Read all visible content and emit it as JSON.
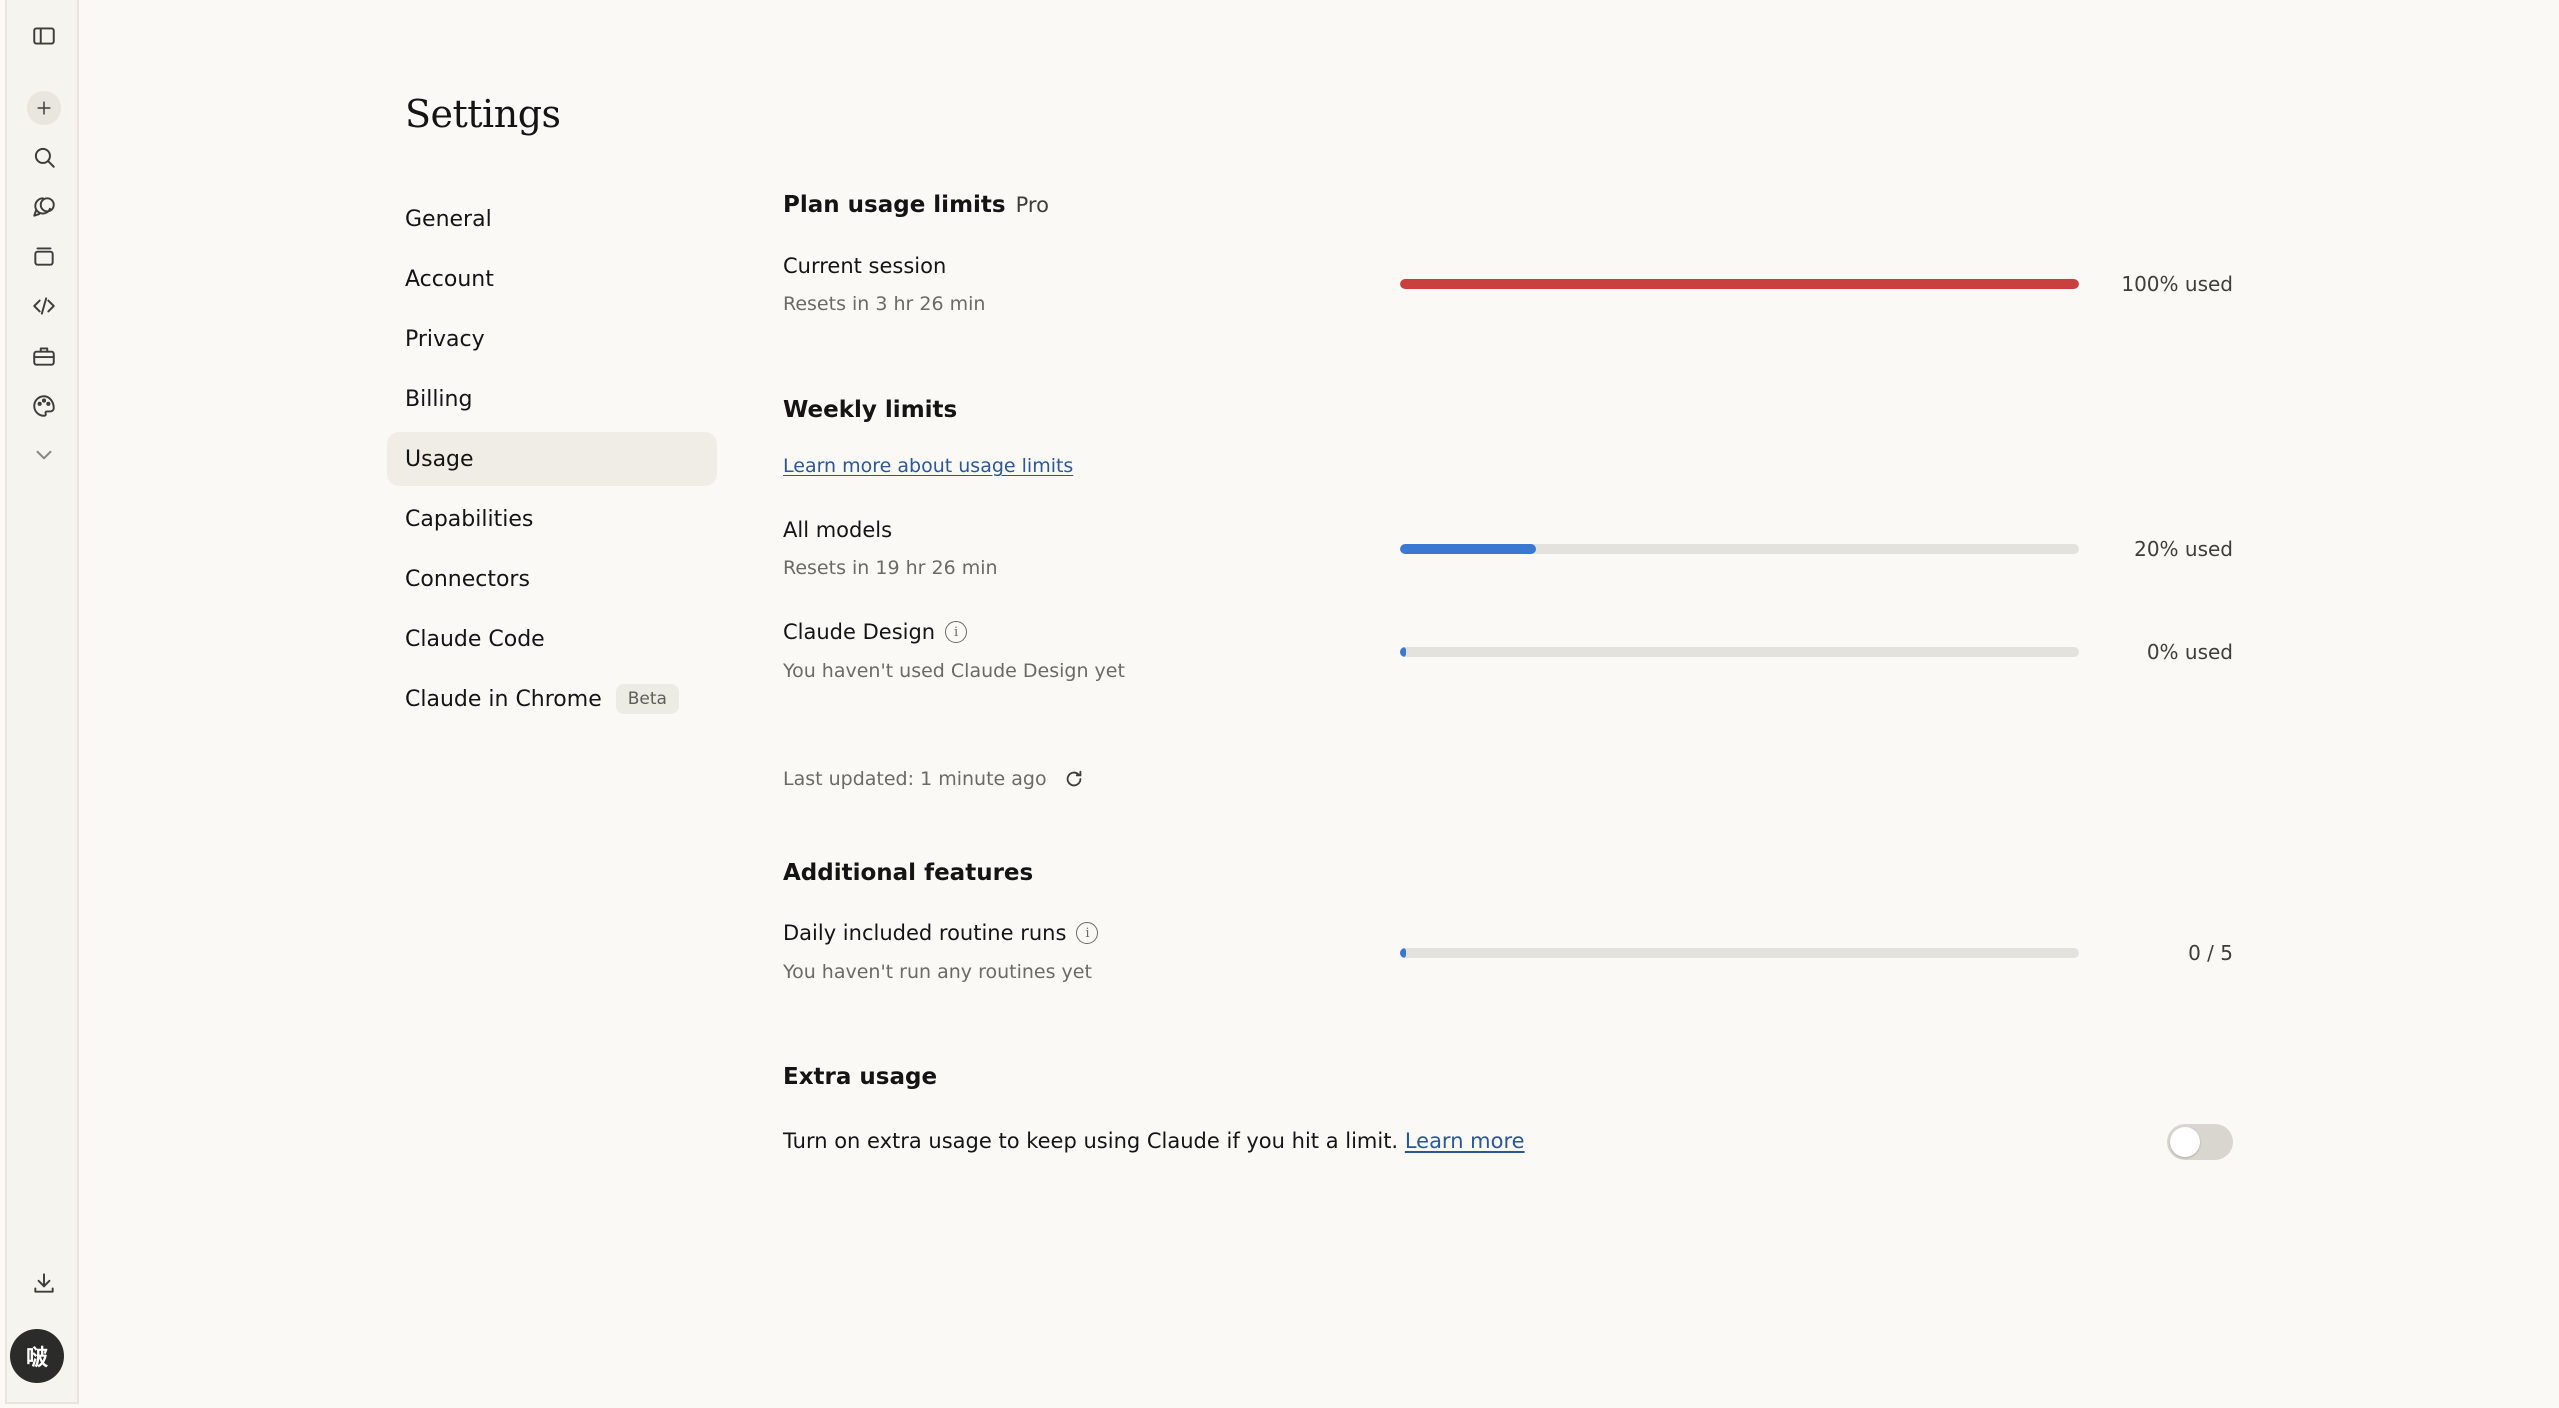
{
  "sidebar_icons": [
    "sidebar-toggle-icon",
    "plus-icon",
    "search-icon",
    "chats-icon",
    "projects-icon",
    "code-icon",
    "toolbox-icon",
    "palette-icon",
    "chevron-down-icon",
    "download-icon"
  ],
  "user": {
    "avatar_initial": "啵"
  },
  "page": {
    "title": "Settings"
  },
  "nav": {
    "items": [
      {
        "label": "General"
      },
      {
        "label": "Account"
      },
      {
        "label": "Privacy"
      },
      {
        "label": "Billing"
      },
      {
        "label": "Usage",
        "active": true
      },
      {
        "label": "Capabilities"
      },
      {
        "label": "Connectors"
      },
      {
        "label": "Claude Code"
      },
      {
        "label": "Claude in Chrome",
        "badge": "Beta"
      }
    ]
  },
  "plan_usage": {
    "title": "Plan usage limits",
    "plan": "Pro",
    "current_session": {
      "label": "Current session",
      "sub": "Resets in 3 hr 26 min",
      "percent": 100,
      "value_text": "100% used",
      "color": "#c9403f"
    }
  },
  "weekly": {
    "title": "Weekly limits",
    "learn_more": "Learn more about usage limits",
    "all_models": {
      "label": "All models",
      "sub": "Resets in 19 hr 26 min",
      "percent": 20,
      "value_text": "20% used",
      "color": "#3b78d1"
    },
    "claude_design": {
      "label": "Claude Design",
      "sub": "You haven't used Claude Design yet",
      "percent": 0,
      "value_text": "0% used",
      "color": "#3b78d1"
    },
    "last_updated": "Last updated: 1 minute ago"
  },
  "additional": {
    "title": "Additional features",
    "routines": {
      "label": "Daily included routine runs",
      "sub": "You haven't run any routines yet",
      "used": 0,
      "total": 5,
      "value_text": "0 / 5",
      "color": "#3b78d1"
    }
  },
  "extra_usage": {
    "title": "Extra usage",
    "text": "Turn on extra usage to keep using Claude if you hit a limit.",
    "learn_more": "Learn more",
    "enabled": false
  }
}
